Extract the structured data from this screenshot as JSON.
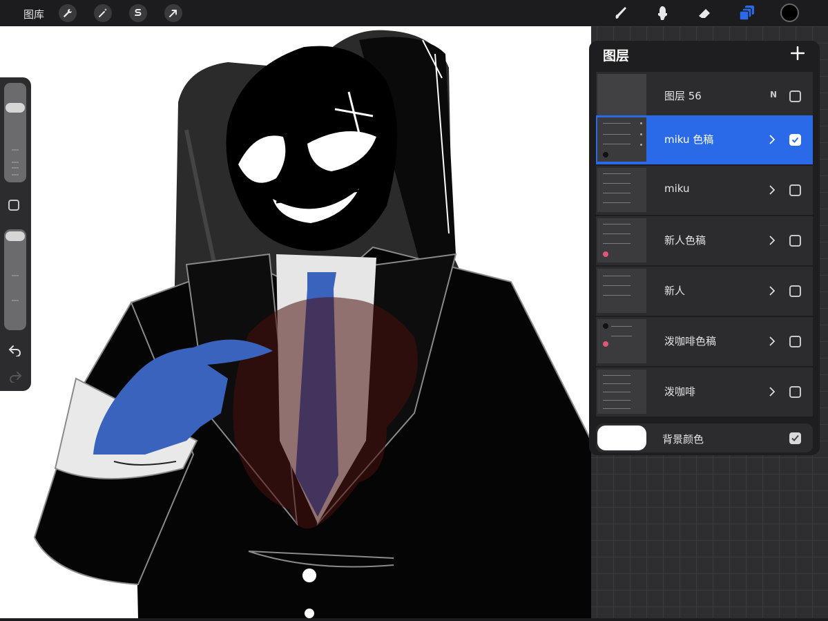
{
  "toolbar": {
    "gallery_label": "图库",
    "left_tools": [
      "wrench-icon",
      "magic-wand-icon",
      "selection-s-icon",
      "transform-arrow-icon"
    ],
    "right_tools": [
      "brush-icon",
      "smudge-icon",
      "eraser-icon",
      "layers-icon"
    ],
    "active_tool": "layers-icon",
    "current_color": "#000000",
    "accent_color": "#2a6ae9"
  },
  "layers_panel": {
    "title": "图层",
    "add_icon": "plus-icon",
    "layers": [
      {
        "name": "图层 56",
        "blend_mode": "N",
        "visible": false,
        "selected": false,
        "is_group": false
      },
      {
        "name": "miku 色稿",
        "visible": true,
        "selected": true,
        "is_group": true
      },
      {
        "name": "miku",
        "visible": false,
        "selected": false,
        "is_group": true
      },
      {
        "name": "新人色稿",
        "visible": false,
        "selected": false,
        "is_group": true
      },
      {
        "name": "新人",
        "visible": false,
        "selected": false,
        "is_group": true
      },
      {
        "name": "泼咖啡色稿",
        "visible": false,
        "selected": false,
        "is_group": true
      },
      {
        "name": "泼咖啡",
        "visible": false,
        "selected": false,
        "is_group": true
      }
    ],
    "background": {
      "name": "背景颜色",
      "color": "#ffffff",
      "visible": true
    }
  },
  "sidebar": {
    "brush_size_icon": "brush-size-slider",
    "opacity_icon": "opacity-slider",
    "modify_button_icon": "square-modify-icon",
    "undo_icon": "undo-icon",
    "redo_icon": "redo-icon"
  },
  "canvas": {
    "artwork": "illustration-character-in-black-suit-with-blue-tie-and-blue-hand"
  }
}
